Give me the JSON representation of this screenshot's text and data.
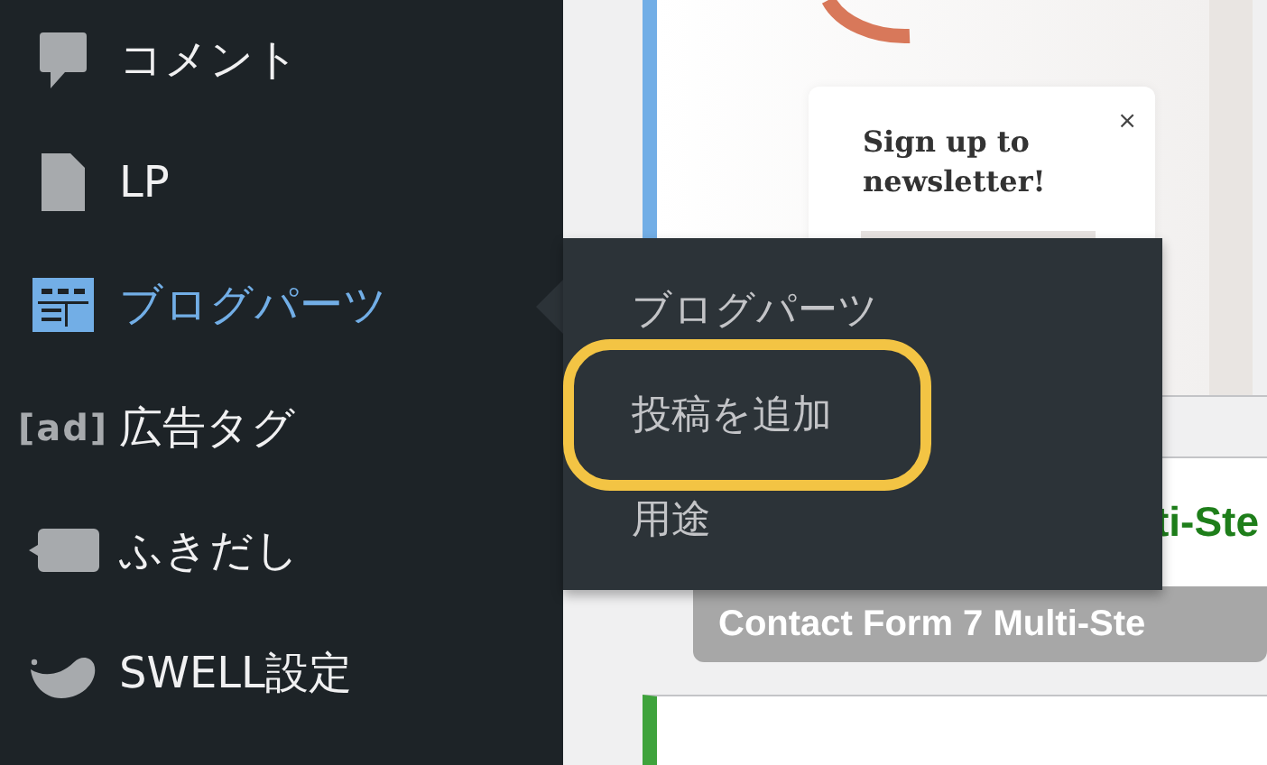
{
  "sidebar": {
    "items": [
      {
        "label": "コメント",
        "kind": "comment",
        "selected": false
      },
      {
        "label": "LP",
        "kind": "page",
        "selected": false
      },
      {
        "label": "ブログパーツ",
        "kind": "grid",
        "selected": true
      },
      {
        "label": "広告タグ",
        "kind": "ad",
        "icon_text": "[ad]",
        "selected": false
      },
      {
        "label": "ふきだし",
        "kind": "balloon",
        "selected": false
      },
      {
        "label": "SWELL設定",
        "kind": "swell",
        "selected": false
      }
    ]
  },
  "flyout": {
    "items": [
      {
        "label": "ブログパーツ",
        "highlighted": false
      },
      {
        "label": "投稿を追加",
        "highlighted": true
      },
      {
        "label": "用途",
        "highlighted": false
      }
    ]
  },
  "preview": {
    "popup_title": "Sign up to newsletter!",
    "close": "×"
  },
  "row": {
    "title": "ti-Ste"
  },
  "badge": "Contact Form 7 Multi-Ste"
}
